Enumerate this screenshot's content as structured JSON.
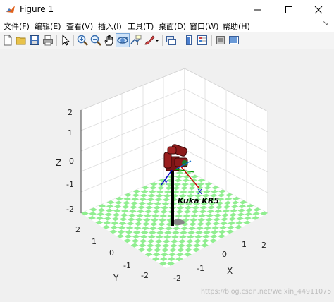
{
  "window": {
    "title": "Figure 1"
  },
  "menu": [
    {
      "label": "文件(F)"
    },
    {
      "label": "编辑(E)"
    },
    {
      "label": "查看(V)"
    },
    {
      "label": "插入(I)"
    },
    {
      "label": "工具(T)"
    },
    {
      "label": "桌面(D)"
    },
    {
      "label": "窗口(W)"
    },
    {
      "label": "帮助(H)"
    }
  ],
  "toolbar": {
    "icons": [
      "new-figure-icon",
      "open-file-icon",
      "save-icon",
      "print-icon",
      "pointer-icon",
      "zoom-in-icon",
      "zoom-out-icon",
      "pan-icon",
      "rotate-3d-icon",
      "data-cursor-icon",
      "brush-icon",
      "link-plot-icon",
      "colorbar-icon",
      "legend-icon",
      "hide-plot-tools-icon",
      "show-plot-tools-icon"
    ],
    "active": "rotate-3d-icon"
  },
  "axes": {
    "xlabel": "X",
    "ylabel": "Y",
    "zlabel": "Z",
    "x_ticks": [
      "-2",
      "-1",
      "0",
      "1",
      "2"
    ],
    "y_ticks": [
      "2",
      "1",
      "0",
      "-1",
      "-2"
    ],
    "z_ticks": [
      "2",
      "1",
      "0",
      "-1",
      "-2"
    ],
    "grid": true
  },
  "robot": {
    "name": "Kuka KR5",
    "tool_axis_label": "X",
    "link_color": "#8b1a1a",
    "floor_colors": [
      "#90ee90",
      "#ffffff"
    ]
  },
  "watermark": "https://blog.csdn.net/weixin_44911075"
}
